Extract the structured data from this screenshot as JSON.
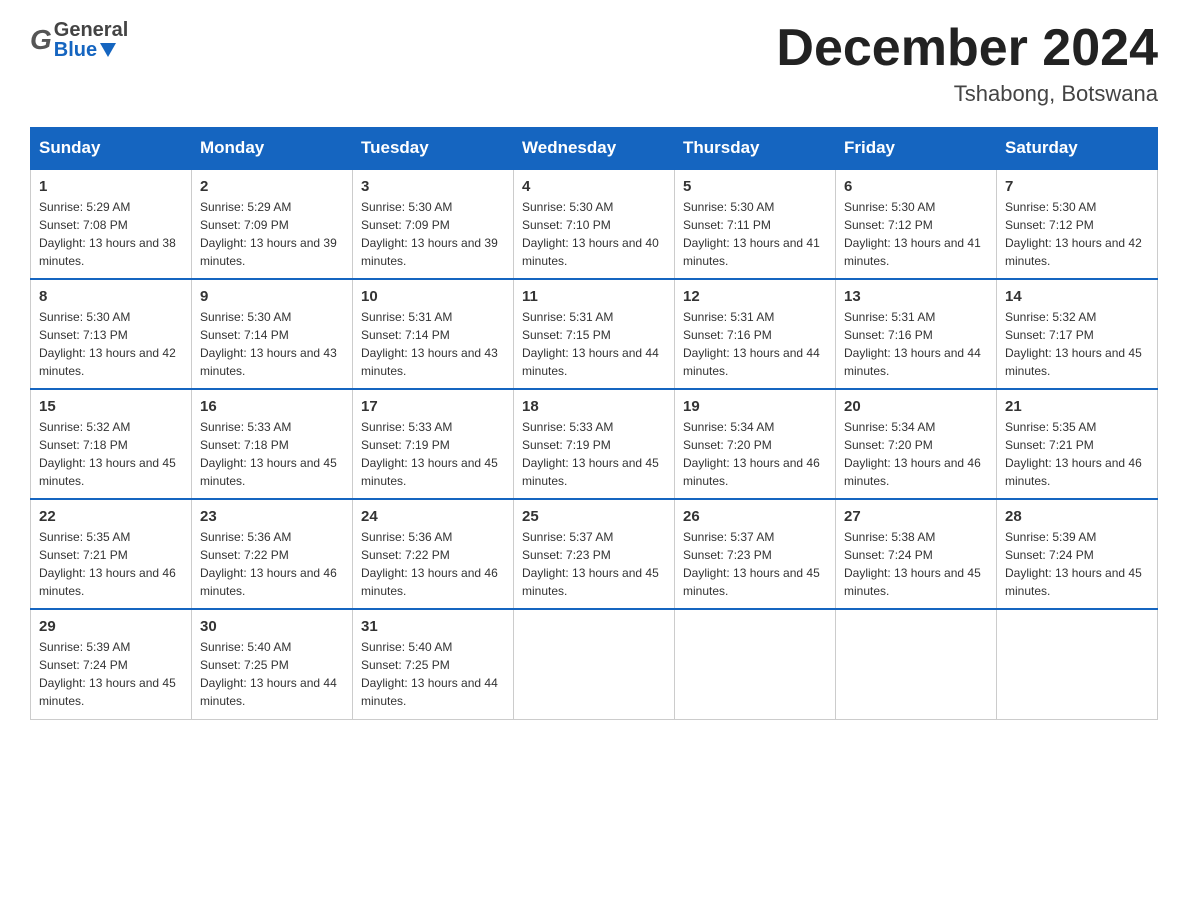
{
  "header": {
    "logo_general": "General",
    "logo_blue": "Blue",
    "title": "December 2024",
    "subtitle": "Tshabong, Botswana"
  },
  "calendar": {
    "days_of_week": [
      "Sunday",
      "Monday",
      "Tuesday",
      "Wednesday",
      "Thursday",
      "Friday",
      "Saturday"
    ],
    "weeks": [
      [
        {
          "day": "1",
          "sunrise": "Sunrise: 5:29 AM",
          "sunset": "Sunset: 7:08 PM",
          "daylight": "Daylight: 13 hours and 38 minutes."
        },
        {
          "day": "2",
          "sunrise": "Sunrise: 5:29 AM",
          "sunset": "Sunset: 7:09 PM",
          "daylight": "Daylight: 13 hours and 39 minutes."
        },
        {
          "day": "3",
          "sunrise": "Sunrise: 5:30 AM",
          "sunset": "Sunset: 7:09 PM",
          "daylight": "Daylight: 13 hours and 39 minutes."
        },
        {
          "day": "4",
          "sunrise": "Sunrise: 5:30 AM",
          "sunset": "Sunset: 7:10 PM",
          "daylight": "Daylight: 13 hours and 40 minutes."
        },
        {
          "day": "5",
          "sunrise": "Sunrise: 5:30 AM",
          "sunset": "Sunset: 7:11 PM",
          "daylight": "Daylight: 13 hours and 41 minutes."
        },
        {
          "day": "6",
          "sunrise": "Sunrise: 5:30 AM",
          "sunset": "Sunset: 7:12 PM",
          "daylight": "Daylight: 13 hours and 41 minutes."
        },
        {
          "day": "7",
          "sunrise": "Sunrise: 5:30 AM",
          "sunset": "Sunset: 7:12 PM",
          "daylight": "Daylight: 13 hours and 42 minutes."
        }
      ],
      [
        {
          "day": "8",
          "sunrise": "Sunrise: 5:30 AM",
          "sunset": "Sunset: 7:13 PM",
          "daylight": "Daylight: 13 hours and 42 minutes."
        },
        {
          "day": "9",
          "sunrise": "Sunrise: 5:30 AM",
          "sunset": "Sunset: 7:14 PM",
          "daylight": "Daylight: 13 hours and 43 minutes."
        },
        {
          "day": "10",
          "sunrise": "Sunrise: 5:31 AM",
          "sunset": "Sunset: 7:14 PM",
          "daylight": "Daylight: 13 hours and 43 minutes."
        },
        {
          "day": "11",
          "sunrise": "Sunrise: 5:31 AM",
          "sunset": "Sunset: 7:15 PM",
          "daylight": "Daylight: 13 hours and 44 minutes."
        },
        {
          "day": "12",
          "sunrise": "Sunrise: 5:31 AM",
          "sunset": "Sunset: 7:16 PM",
          "daylight": "Daylight: 13 hours and 44 minutes."
        },
        {
          "day": "13",
          "sunrise": "Sunrise: 5:31 AM",
          "sunset": "Sunset: 7:16 PM",
          "daylight": "Daylight: 13 hours and 44 minutes."
        },
        {
          "day": "14",
          "sunrise": "Sunrise: 5:32 AM",
          "sunset": "Sunset: 7:17 PM",
          "daylight": "Daylight: 13 hours and 45 minutes."
        }
      ],
      [
        {
          "day": "15",
          "sunrise": "Sunrise: 5:32 AM",
          "sunset": "Sunset: 7:18 PM",
          "daylight": "Daylight: 13 hours and 45 minutes."
        },
        {
          "day": "16",
          "sunrise": "Sunrise: 5:33 AM",
          "sunset": "Sunset: 7:18 PM",
          "daylight": "Daylight: 13 hours and 45 minutes."
        },
        {
          "day": "17",
          "sunrise": "Sunrise: 5:33 AM",
          "sunset": "Sunset: 7:19 PM",
          "daylight": "Daylight: 13 hours and 45 minutes."
        },
        {
          "day": "18",
          "sunrise": "Sunrise: 5:33 AM",
          "sunset": "Sunset: 7:19 PM",
          "daylight": "Daylight: 13 hours and 45 minutes."
        },
        {
          "day": "19",
          "sunrise": "Sunrise: 5:34 AM",
          "sunset": "Sunset: 7:20 PM",
          "daylight": "Daylight: 13 hours and 46 minutes."
        },
        {
          "day": "20",
          "sunrise": "Sunrise: 5:34 AM",
          "sunset": "Sunset: 7:20 PM",
          "daylight": "Daylight: 13 hours and 46 minutes."
        },
        {
          "day": "21",
          "sunrise": "Sunrise: 5:35 AM",
          "sunset": "Sunset: 7:21 PM",
          "daylight": "Daylight: 13 hours and 46 minutes."
        }
      ],
      [
        {
          "day": "22",
          "sunrise": "Sunrise: 5:35 AM",
          "sunset": "Sunset: 7:21 PM",
          "daylight": "Daylight: 13 hours and 46 minutes."
        },
        {
          "day": "23",
          "sunrise": "Sunrise: 5:36 AM",
          "sunset": "Sunset: 7:22 PM",
          "daylight": "Daylight: 13 hours and 46 minutes."
        },
        {
          "day": "24",
          "sunrise": "Sunrise: 5:36 AM",
          "sunset": "Sunset: 7:22 PM",
          "daylight": "Daylight: 13 hours and 46 minutes."
        },
        {
          "day": "25",
          "sunrise": "Sunrise: 5:37 AM",
          "sunset": "Sunset: 7:23 PM",
          "daylight": "Daylight: 13 hours and 45 minutes."
        },
        {
          "day": "26",
          "sunrise": "Sunrise: 5:37 AM",
          "sunset": "Sunset: 7:23 PM",
          "daylight": "Daylight: 13 hours and 45 minutes."
        },
        {
          "day": "27",
          "sunrise": "Sunrise: 5:38 AM",
          "sunset": "Sunset: 7:24 PM",
          "daylight": "Daylight: 13 hours and 45 minutes."
        },
        {
          "day": "28",
          "sunrise": "Sunrise: 5:39 AM",
          "sunset": "Sunset: 7:24 PM",
          "daylight": "Daylight: 13 hours and 45 minutes."
        }
      ],
      [
        {
          "day": "29",
          "sunrise": "Sunrise: 5:39 AM",
          "sunset": "Sunset: 7:24 PM",
          "daylight": "Daylight: 13 hours and 45 minutes."
        },
        {
          "day": "30",
          "sunrise": "Sunrise: 5:40 AM",
          "sunset": "Sunset: 7:25 PM",
          "daylight": "Daylight: 13 hours and 44 minutes."
        },
        {
          "day": "31",
          "sunrise": "Sunrise: 5:40 AM",
          "sunset": "Sunset: 7:25 PM",
          "daylight": "Daylight: 13 hours and 44 minutes."
        },
        null,
        null,
        null,
        null
      ]
    ]
  }
}
